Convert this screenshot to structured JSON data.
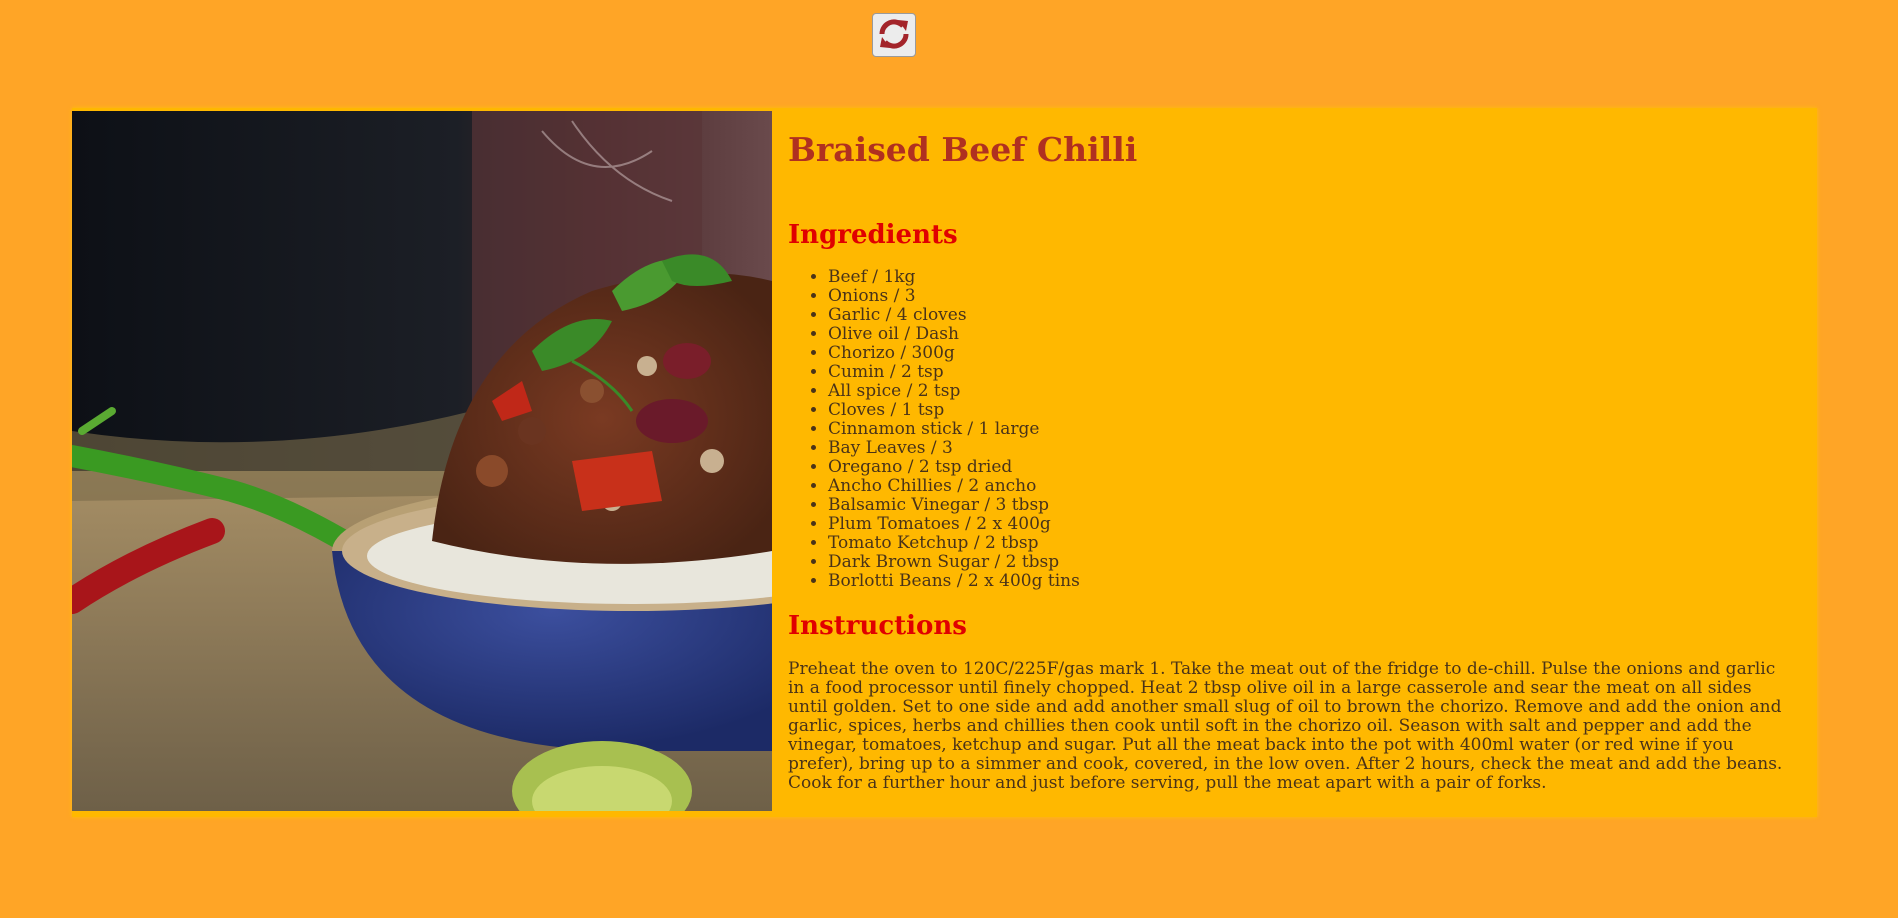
{
  "toolbar": {
    "refresh_icon": "refresh-icon",
    "refresh_color": "#a3242a"
  },
  "recipe": {
    "title": "Braised Beef Chilli",
    "photo_icon": "chilli-bowl-photo",
    "ingredients_heading": "Ingredients",
    "ingredients": [
      "Beef / 1kg",
      "Onions / 3",
      "Garlic / 4 cloves",
      "Olive oil / Dash",
      "Chorizo / 300g",
      "Cumin / 2 tsp",
      "All spice / 2 tsp",
      "Cloves / 1 tsp",
      "Cinnamon stick / 1 large",
      "Bay Leaves / 3",
      "Oregano / 2 tsp dried",
      "Ancho Chillies / 2 ancho",
      "Balsamic Vinegar / 3 tbsp",
      "Plum Tomatoes / 2 x 400g",
      "Tomato Ketchup / 2 tbsp",
      "Dark Brown Sugar / 2 tbsp",
      "Borlotti Beans / 2 x 400g tins"
    ],
    "instructions_heading": "Instructions",
    "instructions": "Preheat the oven to 120C/225F/gas mark 1. Take the meat out of the fridge to de-chill. Pulse the onions and garlic in a food processor until finely chopped. Heat 2 tbsp olive oil in a large casserole and sear the meat on all sides until golden. Set to one side and add another small slug of oil to brown the chorizo. Remove and add the onion and garlic, spices, herbs and chillies then cook until soft in the chorizo oil. Season with salt and pepper and add the vinegar, tomatoes, ketchup and sugar. Put all the meat back into the pot with 400ml water (or red wine if you prefer), bring up to a simmer and cook, covered, in the low oven. After 2 hours, check the meat and add the beans. Cook for a further hour and just before serving, pull the meat apart with a pair of forks."
  },
  "colors": {
    "page_background": "#ffa526",
    "card_background": "#ffb800",
    "title": "#b03020",
    "heading": "#e00000",
    "body_text": "#4a3318"
  }
}
